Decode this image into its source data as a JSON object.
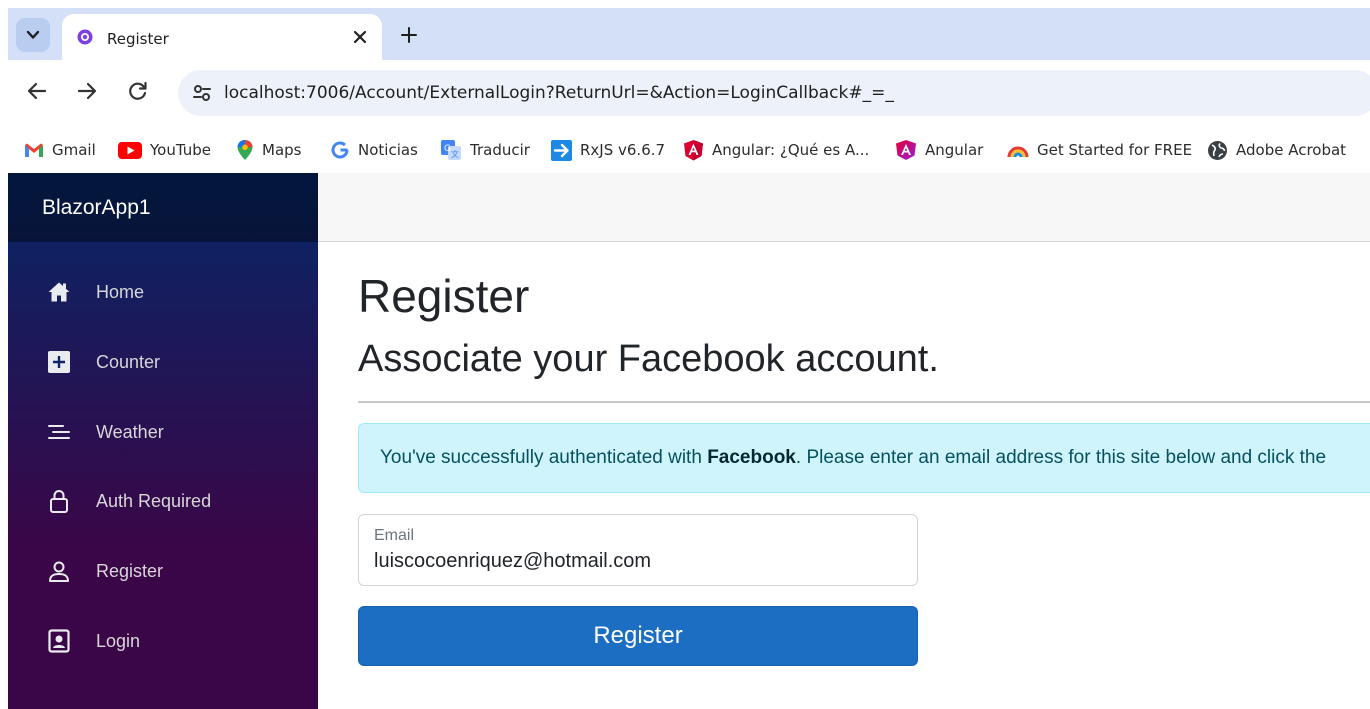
{
  "browser": {
    "tab": {
      "title": "Register"
    },
    "url": "localhost:7006/Account/ExternalLogin?ReturnUrl=&Action=LoginCallback#_=_",
    "bookmarks": [
      {
        "label": "Gmail",
        "icon": "gmail-icon"
      },
      {
        "label": "YouTube",
        "icon": "youtube-icon"
      },
      {
        "label": "Maps",
        "icon": "maps-icon"
      },
      {
        "label": "Noticias",
        "icon": "google-news-icon"
      },
      {
        "label": "Traducir",
        "icon": "translate-icon"
      },
      {
        "label": "RxJS v6.6.7",
        "icon": "rxjs-icon"
      },
      {
        "label": "Angular: ¿Qué es A...",
        "icon": "angular-icon"
      },
      {
        "label": "Angular",
        "icon": "angular-new-icon"
      },
      {
        "label": "Get Started for FREE",
        "icon": "rainbow-icon"
      },
      {
        "label": "Adobe Acrobat",
        "icon": "globe-icon"
      }
    ]
  },
  "sidebar": {
    "brand": "BlazorApp1",
    "items": [
      {
        "label": "Home",
        "icon": "home-icon"
      },
      {
        "label": "Counter",
        "icon": "plus-square-icon"
      },
      {
        "label": "Weather",
        "icon": "list-icon"
      },
      {
        "label": "Auth Required",
        "icon": "lock-icon"
      },
      {
        "label": "Register",
        "icon": "person-icon"
      },
      {
        "label": "Login",
        "icon": "badge-icon"
      }
    ]
  },
  "main": {
    "title": "Register",
    "subtitle": "Associate your Facebook account.",
    "alert": {
      "prefix": "You've successfully authenticated with ",
      "provider": "Facebook",
      "suffix": ". Please enter an email address for this site below and click the"
    },
    "email": {
      "label": "Email",
      "value": "luiscocoenriquez@hotmail.com"
    },
    "submit_label": "Register"
  },
  "colors": {
    "sidebar_top": "#052767",
    "sidebar_bottom": "#3a0647",
    "primary_button": "#1b6ec2",
    "alert_bg": "#cff4fc"
  }
}
